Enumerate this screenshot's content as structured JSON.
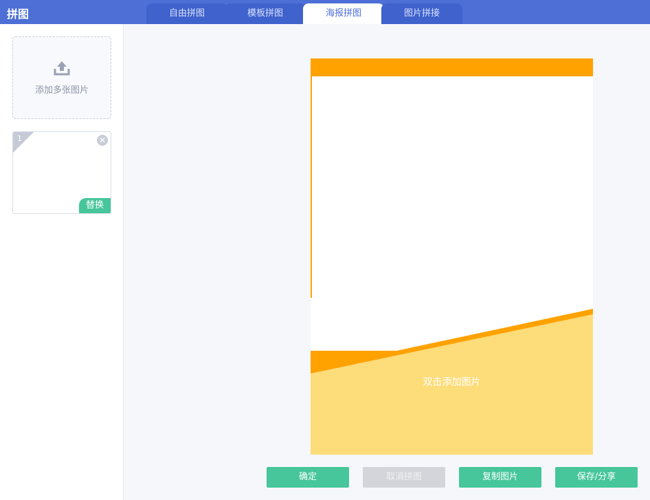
{
  "app": {
    "title": "拼图"
  },
  "tabs": [
    {
      "label": "自由拼图",
      "active": false
    },
    {
      "label": "模板拼图",
      "active": false
    },
    {
      "label": "海报拼图",
      "active": true
    },
    {
      "label": "图片拼接",
      "active": false
    }
  ],
  "sidebar": {
    "add_label": "添加多张图片",
    "upload_icon": "upload-icon",
    "thumbnails": [
      {
        "index": "1",
        "replace_label": "替换",
        "close_icon": "close-icon"
      }
    ]
  },
  "poster": {
    "hint": "双击添加图片",
    "colors": {
      "accent": "#ffa200",
      "fill": "#fddc7a"
    }
  },
  "actions": {
    "confirm": "确定",
    "cancel": "取消拼图",
    "copy": "复制图片",
    "save": "保存/分享"
  },
  "colors": {
    "header": "#4d6fd6",
    "button": "#46c69a",
    "button_disabled": "#d3d5da"
  }
}
